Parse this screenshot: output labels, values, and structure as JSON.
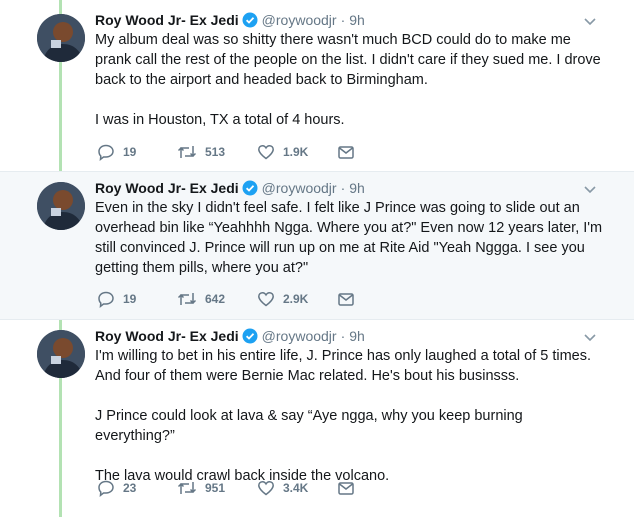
{
  "tweets": [
    {
      "name": "Roy Wood Jr- Ex Jedi",
      "handle": "@roywoodjr",
      "separator": "·",
      "time": "9h",
      "text": "My album deal was so shitty there wasn't much BCD could do to make me prank call the rest of the people on the list. I didn't care if they sued me. I drove back to the airport and headed back to Birmingham.\n\nI was in Houston, TX a total of 4 hours.",
      "replies": "19",
      "retweets": "513",
      "likes": "1.9K",
      "highlighted": false
    },
    {
      "name": "Roy Wood Jr- Ex Jedi",
      "handle": "@roywoodjr",
      "separator": "·",
      "time": "9h",
      "text": "Even in the sky I didn't feel safe. I felt like J Prince was going to slide out an overhead bin like “Yeahhhh Ngga. Where you at?\" Even now 12 years later, I'm still convinced J. Prince will run up on me at Rite Aid \"Yeah Nggga. I see you getting them pills, where you at?\"",
      "replies": "19",
      "retweets": "642",
      "likes": "2.9K",
      "highlighted": true
    },
    {
      "name": "Roy Wood Jr- Ex Jedi",
      "handle": "@roywoodjr",
      "separator": "·",
      "time": "9h",
      "text": "I'm willing to bet in his entire life, J. Prince has only laughed a total of 5 times. And four of them were Bernie Mac related. He's bout his businsss.\n\nJ Prince could look at lava & say “Aye ngga, why you keep burning everything?”\n\nThe lava would crawl back inside the volcano.",
      "replies": "23",
      "retweets": "951",
      "likes": "3.4K",
      "highlighted": false
    }
  ],
  "icons": {
    "reply": "reply-icon",
    "retweet": "retweet-icon",
    "like": "heart-icon",
    "dm": "envelope-icon",
    "verified": "verified-badge-icon",
    "more": "chevron-down-icon"
  },
  "colors": {
    "thread_line": "#b3e2b3",
    "verified": "#1da1f2",
    "secondary_text": "#657786",
    "highlight_bg": "#f5f8fa"
  }
}
